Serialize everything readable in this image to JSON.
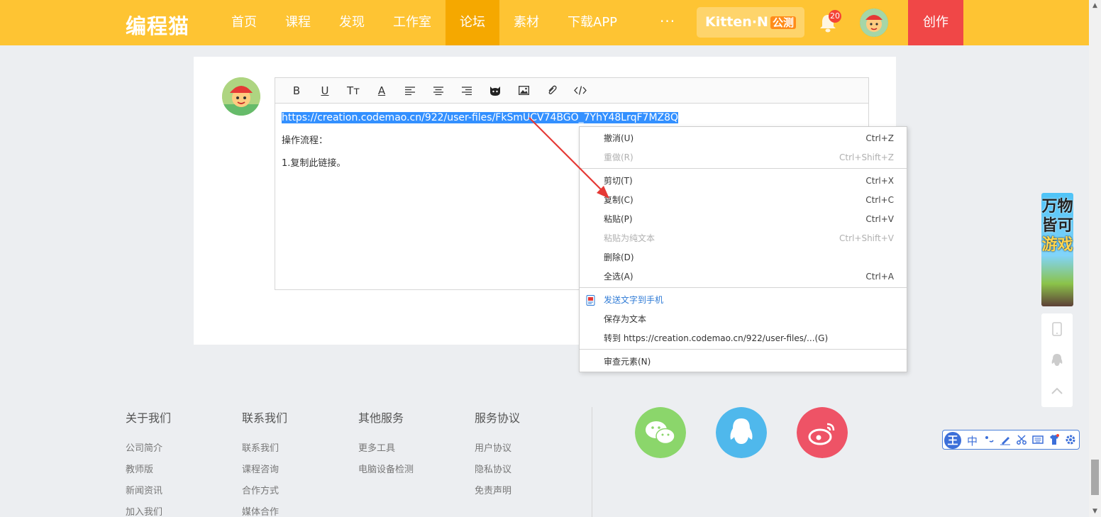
{
  "header": {
    "logo": "编程猫",
    "nav": [
      {
        "label": "首页",
        "active": false
      },
      {
        "label": "课程",
        "active": false
      },
      {
        "label": "发现",
        "active": false
      },
      {
        "label": "工作室",
        "active": false
      },
      {
        "label": "论坛",
        "active": true
      },
      {
        "label": "素材",
        "active": false
      },
      {
        "label": "下载APP",
        "active": false
      }
    ],
    "more": "···",
    "kitten": {
      "label": "Kitten·N",
      "tag": "公测"
    },
    "notification_count": "20",
    "create_label": "创作"
  },
  "editor": {
    "toolbar_icons": [
      "bold-icon",
      "underline-icon",
      "text-size-icon",
      "text-color-icon",
      "align-left-icon",
      "align-center-icon",
      "align-right-icon",
      "emoji-cat-icon",
      "image-icon",
      "attachment-icon",
      "code-icon"
    ],
    "toolbar_glyphs": {
      "bold": "B",
      "underline": "U",
      "text_size": "Tт",
      "text_color": "A"
    },
    "selected_link": "https://creation.codemao.cn/922/user-files/FkSmUCV74BGO_7YhY48LrqF7MZ8Q",
    "line1": "操作流程：",
    "line2": "1.复制此链接。"
  },
  "context_menu": {
    "undo": {
      "label": "撤消(U)",
      "shortcut": "Ctrl+Z"
    },
    "redo": {
      "label": "重做(R)",
      "shortcut": "Ctrl+Shift+Z"
    },
    "cut": {
      "label": "剪切(T)",
      "shortcut": "Ctrl+X"
    },
    "copy": {
      "label": "复制(C)",
      "shortcut": "Ctrl+C"
    },
    "paste": {
      "label": "粘贴(P)",
      "shortcut": "Ctrl+V"
    },
    "paste_plain": {
      "label": "粘贴为纯文本",
      "shortcut": "Ctrl+Shift+V"
    },
    "delete": {
      "label": "删除(D)"
    },
    "select_all": {
      "label": "全选(A)",
      "shortcut": "Ctrl+A"
    },
    "send_to_phone": {
      "label": "发送文字到手机"
    },
    "save_as_text": {
      "label": "保存为文本"
    },
    "goto": {
      "label": "转到 https://creation.codemao.cn/922/user-files/...(G)"
    },
    "inspect": {
      "label": "审查元素(N)"
    }
  },
  "banner": {
    "line1": "万物",
    "line2": "皆可",
    "line3": "游戏"
  },
  "footer": {
    "cols": [
      {
        "title": "关于我们",
        "links": [
          "公司简介",
          "教师版",
          "新闻资讯",
          "加入我们"
        ]
      },
      {
        "title": "联系我们",
        "links": [
          "联系我们",
          "课程咨询",
          "合作方式",
          "媒体合作"
        ]
      },
      {
        "title": "其他服务",
        "links": [
          "更多工具",
          "电脑设备检测"
        ]
      },
      {
        "title": "服务协议",
        "links": [
          "用户协议",
          "隐私协议",
          "免责声明"
        ]
      }
    ]
  },
  "ime": {
    "logo": "王",
    "mode": "中"
  },
  "colors": {
    "brand": "#fec433",
    "create": "#f04747",
    "wechat": "#8bd66b",
    "qq": "#4fb8ec",
    "weibo": "#ee5366",
    "selection": "#3390ff",
    "arrow": "#e53935"
  }
}
